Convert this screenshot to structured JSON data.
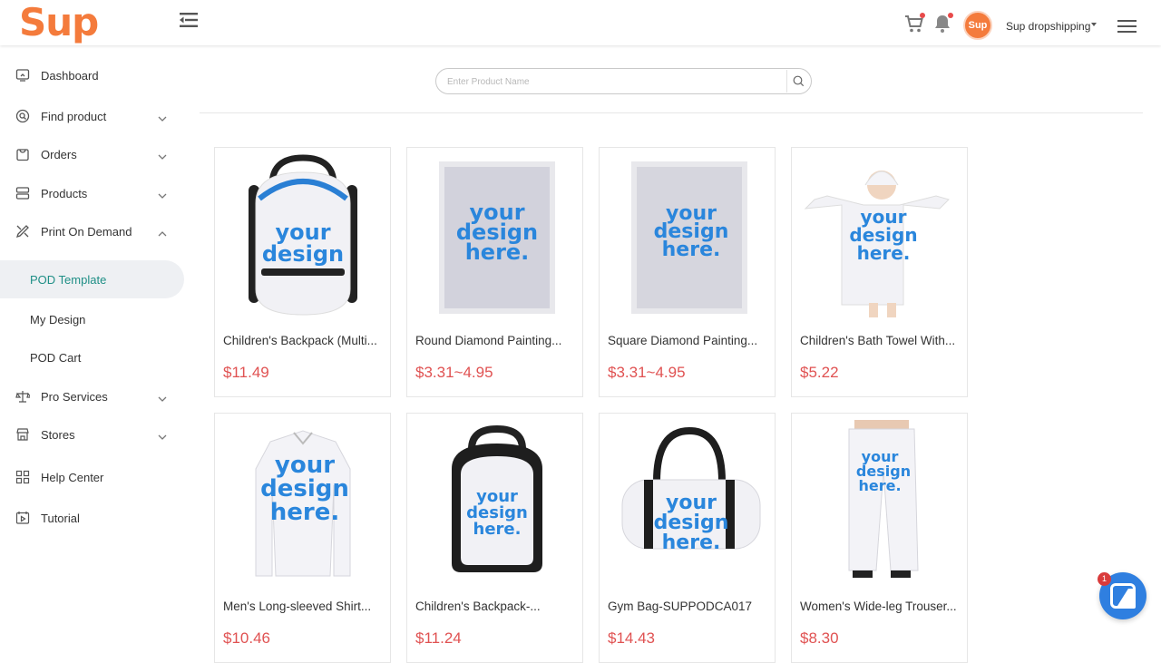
{
  "brand": {
    "logo_text": "Sup",
    "accent": "#f47b3c"
  },
  "header": {
    "avatar_text": "Sup",
    "user_name": "Sup dropshipping",
    "cart_icon": "cart-icon",
    "bell_icon": "bell-icon",
    "menu_icon": "hamburger-icon"
  },
  "sidebar": {
    "items": [
      {
        "label": "Dashboard",
        "icon": "dashboard-icon"
      },
      {
        "label": "Find product",
        "icon": "find-product-icon"
      },
      {
        "label": "Orders",
        "icon": "orders-icon"
      },
      {
        "label": "Products",
        "icon": "products-icon"
      },
      {
        "label": "Print On Demand",
        "icon": "print-on-demand-icon"
      },
      {
        "label": "Pro Services",
        "icon": "pro-services-icon"
      },
      {
        "label": "Stores",
        "icon": "stores-icon"
      },
      {
        "label": "Help Center",
        "icon": "help-center-icon"
      },
      {
        "label": "Tutorial",
        "icon": "tutorial-icon"
      }
    ],
    "pod_sub_items": [
      {
        "label": "POD Template",
        "active": true
      },
      {
        "label": "My Design",
        "active": false
      },
      {
        "label": "POD Cart",
        "active": false
      }
    ]
  },
  "search": {
    "placeholder": "Enter Product Name"
  },
  "products": [
    {
      "name": "Children's Backpack (Multi...",
      "price": "$11.49",
      "kind": "backpack-a"
    },
    {
      "name": "Round Diamond Painting...",
      "price": "$3.31~4.95",
      "kind": "diamond-round"
    },
    {
      "name": "Square Diamond Painting...",
      "price": "$3.31~4.95",
      "kind": "diamond-square"
    },
    {
      "name": "Children's Bath Towel With...",
      "price": "$5.22",
      "kind": "towel"
    },
    {
      "name": "Men's Long-sleeved Shirt...",
      "price": "$10.46",
      "kind": "shirt"
    },
    {
      "name": "Children's Backpack-...",
      "price": "$11.24",
      "kind": "backpack-b"
    },
    {
      "name": "Gym Bag-SUPPODCA017",
      "price": "$14.43",
      "kind": "gym-bag"
    },
    {
      "name": "Women's Wide-leg Trouser...",
      "price": "$8.30",
      "kind": "trousers"
    }
  ],
  "design_text": [
    "your",
    "design",
    "here."
  ],
  "chat": {
    "badge": "1"
  }
}
